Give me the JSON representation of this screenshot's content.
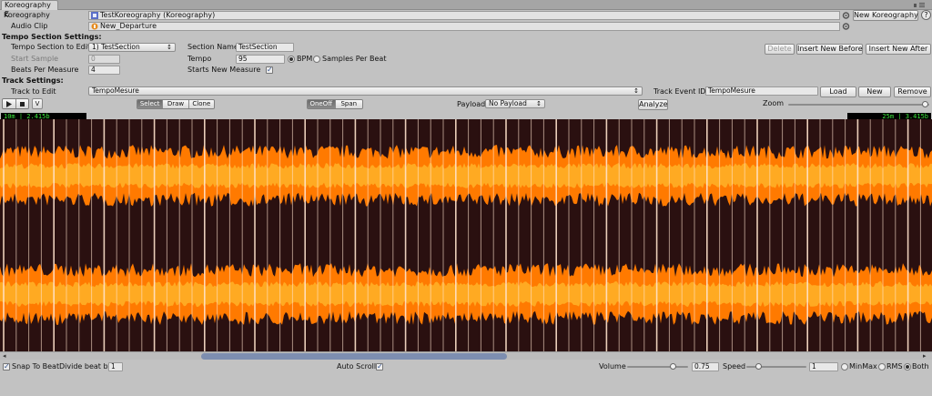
{
  "window": {
    "tab_title": "Koreography E"
  },
  "koreography": {
    "label": "Koreography",
    "value": "TestKoreography (Koreography)",
    "new_button": "New Koreography",
    "help": "?"
  },
  "audio_clip": {
    "label": "Audio Clip",
    "value": "New_Departure"
  },
  "tempo_section": {
    "header": "Tempo Section Settings:",
    "edit_label": "Tempo Section to Edit",
    "edit_value": "1) TestSection",
    "start_sample_label": "Start Sample",
    "start_sample_value": "0",
    "beats_label": "Beats Per Measure",
    "beats_value": "4",
    "section_name_label": "Section Name",
    "section_name_value": "TestSection",
    "tempo_label": "Tempo",
    "tempo_value": "95",
    "bpm_label": "BPM",
    "samples_label": "Samples Per Beat",
    "starts_new_measure_label": "Starts New Measure",
    "delete_button": "Delete",
    "insert_before_button": "Insert New Before",
    "insert_after_button": "Insert New After"
  },
  "track": {
    "header": "Track Settings:",
    "edit_label": "Track to Edit",
    "edit_value": "TempoMesure",
    "event_id_label": "Track Event ID",
    "event_id_value": "TempoMesure",
    "load_button": "Load",
    "new_button": "New",
    "remove_button": "Remove"
  },
  "toolbar": {
    "v_button": "V",
    "mode_select": "Select",
    "mode_draw": "Draw",
    "mode_clone": "Clone",
    "oneoff": "OneOff",
    "span": "Span",
    "payload_label": "Payload",
    "payload_value": "No Payload",
    "analyze_button": "Analyze",
    "zoom_label": "Zoom",
    "zoom_level": 0.98
  },
  "waveform": {
    "left_readout": "10m | 2.415b",
    "right_readout": "25m | 3.415b",
    "colors": {
      "background": "#2a1010",
      "outer": "#ff7a00",
      "inner": "#ffaa22",
      "beat_line": "#ffe3cc"
    }
  },
  "footer": {
    "snap_label": "Snap To Beat",
    "divide_label": "Divide beat by",
    "divide_value": "1",
    "auto_scroll_label": "Auto Scroll",
    "volume_label": "Volume",
    "volume_value": "0.75",
    "speed_label": "Speed",
    "speed_value": "1",
    "minmax_label": "MinMax",
    "rms_label": "RMS",
    "both_label": "Both"
  }
}
